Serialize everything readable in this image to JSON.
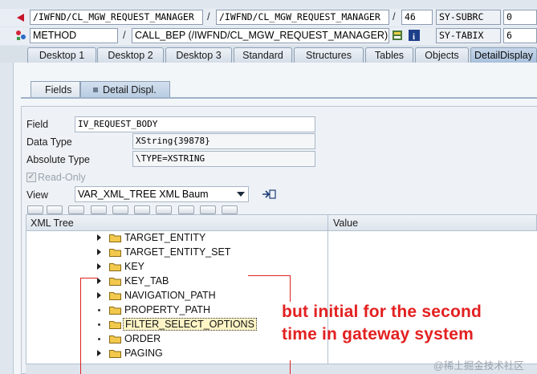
{
  "row1": {
    "program_1": "/IWFND/CL_MGW_REQUEST_MANAGER",
    "program_2": "/IWFND/CL_MGW_REQUEST_MANAGER",
    "line": "46",
    "var_name": "SY-SUBRC",
    "var_value": "0"
  },
  "row2": {
    "event_type": "METHOD",
    "event_name": "CALL_BEP (/IWFND/CL_MGW_REQUEST_MANAGER)",
    "var_name": "SY-TABIX",
    "var_value": "6"
  },
  "separators": {
    "slash": "/"
  },
  "tabs": [
    "Desktop 1",
    "Desktop 2",
    "Desktop 3",
    "Standard",
    "Structures",
    "Tables",
    "Objects",
    "DetailDisplay"
  ],
  "subtabs": [
    "Fields",
    "Detail Displ."
  ],
  "detail": {
    "field_label": "Field",
    "field_value": "IV_REQUEST_BODY",
    "data_type_label": "Data Type",
    "data_type_value": "XString{39878}",
    "abs_type_label": "Absolute Type",
    "abs_type_value": "\\TYPE=XSTRING",
    "readonly_label": "Read-Only",
    "view_label": "View",
    "view_value": "VAR_XML_TREE XML Baum"
  },
  "tree": {
    "col_tree": "XML Tree",
    "col_value": "Value",
    "nodes": [
      {
        "label": "TARGET_ENTITY",
        "expandable": true
      },
      {
        "label": "TARGET_ENTITY_SET",
        "expandable": true
      },
      {
        "label": "KEY",
        "expandable": true
      },
      {
        "label": "KEY_TAB",
        "expandable": true
      },
      {
        "label": "NAVIGATION_PATH",
        "expandable": true
      },
      {
        "label": "PROPERTY_PATH",
        "expandable": false
      },
      {
        "label": "FILTER_SELECT_OPTIONS",
        "expandable": false,
        "selected": true
      },
      {
        "label": "ORDER",
        "expandable": false
      },
      {
        "label": "PAGING",
        "expandable": true
      }
    ]
  },
  "annotation": {
    "line1": "but initial for the second",
    "line2": "time in gateway system",
    "color": "#e32020"
  },
  "watermark": "@稀土掘金技术社区",
  "colors": {
    "folder": "#f2c94c",
    "accent": "#a9c0dc"
  }
}
